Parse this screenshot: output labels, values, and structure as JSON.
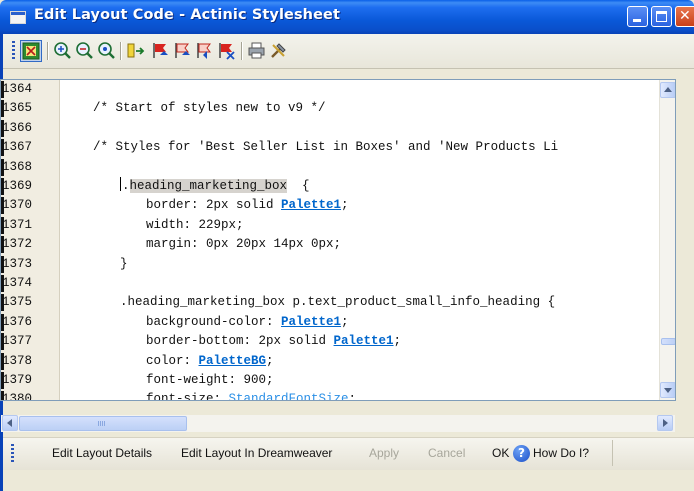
{
  "window": {
    "title": "Edit Layout Code - Actinic Stylesheet"
  },
  "editor": {
    "lines": [
      {
        "num": "1364",
        "text": ""
      },
      {
        "num": "1365",
        "text": "/* Start of styles new to v9 */"
      },
      {
        "num": "1366",
        "text": ""
      },
      {
        "num": "1367",
        "text": "/* Styles for 'Best Seller List in Boxes' and 'New Products Li"
      },
      {
        "num": "1368",
        "text": ""
      },
      {
        "num": "1369",
        "text": ".heading_marketing_box  {"
      },
      {
        "num": "1370",
        "text": "border: 2px solid ",
        "link": "Palette1",
        "after": ";"
      },
      {
        "num": "1371",
        "text": "width: 229px;"
      },
      {
        "num": "1372",
        "text": "margin: 0px 20px 14px 0px;"
      },
      {
        "num": "1373",
        "text": "}"
      },
      {
        "num": "1374",
        "text": ""
      },
      {
        "num": "1375",
        "text": ".heading_marketing_box p.text_product_small_info_heading {"
      },
      {
        "num": "1376",
        "text": "background-color: ",
        "link": "Palette1",
        "after": ";"
      },
      {
        "num": "1377",
        "text": "border-bottom: 2px solid ",
        "link": "Palette1",
        "after": ";"
      },
      {
        "num": "1378",
        "text": "color: ",
        "link": "PaletteBG",
        "after": ";"
      },
      {
        "num": "1379",
        "text": "font-weight: 900;"
      },
      {
        "num": "1380",
        "text": "font-size: ",
        "link2": "StandardFontSize",
        "after": ";"
      }
    ],
    "selected_token": "heading_marketing_box"
  },
  "commands": {
    "edit_details": "Edit Layout Details",
    "edit_dreamweaver": "Edit Layout In Dreamweaver",
    "apply": "Apply",
    "cancel": "Cancel",
    "ok": "OK",
    "how_do_i": "How Do I?"
  },
  "colors": {
    "titlebar": "#0a58d8",
    "link": "#0066cc",
    "gutter": "#f1ede1"
  }
}
